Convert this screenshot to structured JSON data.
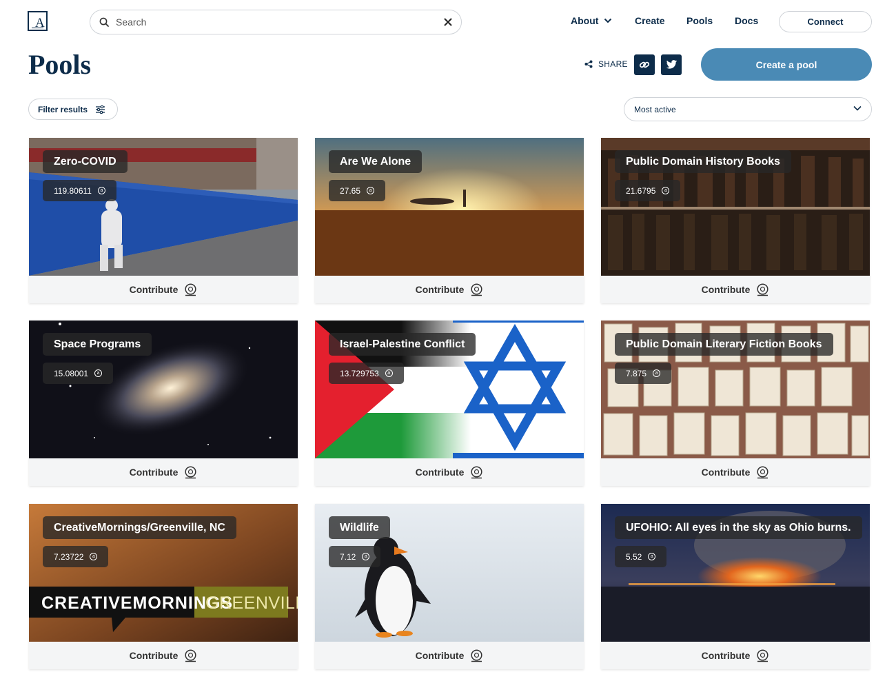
{
  "header": {
    "logo_letter": "A",
    "search": {
      "placeholder": "Search",
      "value": ""
    },
    "nav": [
      {
        "label": "About"
      },
      {
        "label": "Create"
      },
      {
        "label": "Pools"
      },
      {
        "label": "Docs"
      }
    ],
    "connect_label": "Connect"
  },
  "page": {
    "title": "Pools",
    "share_label": "SHARE",
    "create_pool_label": "Create a pool",
    "filter_label": "Filter results",
    "sort_selected": "Most active"
  },
  "colors": {
    "brand_navy": "#0d2c4a",
    "accent_blue": "#4a8ab5",
    "card_footer": "#f4f5f6"
  },
  "pools": [
    {
      "title": "Zero-COVID",
      "value": "119.80611",
      "currency_icon": "ar-icon",
      "contribute_label": "Contribute"
    },
    {
      "title": "Are We Alone",
      "value": "27.65",
      "currency_icon": "ar-icon",
      "contribute_label": "Contribute"
    },
    {
      "title": "Public Domain History Books",
      "value": "21.6795",
      "currency_icon": "ar-icon",
      "contribute_label": "Contribute"
    },
    {
      "title": "Space Programs",
      "value": "15.08001",
      "currency_icon": "ar-icon",
      "contribute_label": "Contribute"
    },
    {
      "title": "Israel-Palestine Conflict",
      "value": "13.729753",
      "currency_icon": "ar-icon",
      "contribute_label": "Contribute"
    },
    {
      "title": "Public Domain Literary Fiction Books",
      "value": "7.875",
      "currency_icon": "ar-icon",
      "contribute_label": "Contribute"
    },
    {
      "title": "CreativeMornings/Greenville, NC",
      "value": "7.23722",
      "currency_icon": "ar-icon",
      "contribute_label": "Contribute",
      "image_text_left": "CREATIVEMORNINGS",
      "image_text_right": "GREENVILLE"
    },
    {
      "title": "Wildlife",
      "value": "7.12",
      "currency_icon": "ar-icon",
      "contribute_label": "Contribute"
    },
    {
      "title": "UFOHIO: All eyes in the sky as Ohio burns.",
      "value": "5.52",
      "currency_icon": "ar-icon",
      "contribute_label": "Contribute"
    }
  ]
}
